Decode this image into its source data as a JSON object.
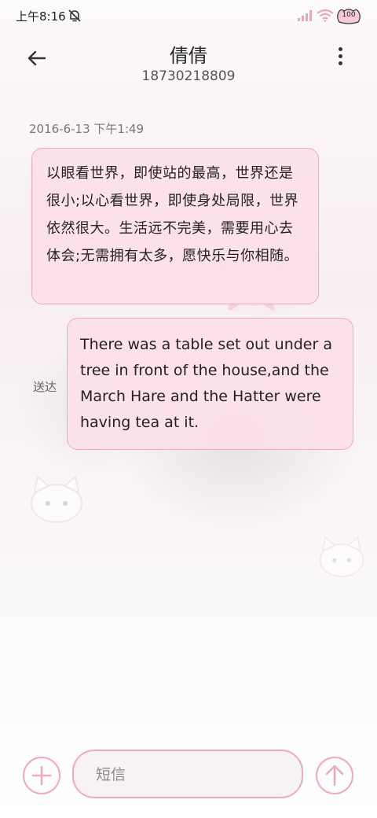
{
  "status_bar": {
    "time": "上午8:16",
    "battery": "100"
  },
  "header": {
    "contact_name": "倩倩",
    "contact_number": "18730218809"
  },
  "conversation": {
    "timestamp": "2016-6-13 下午1:49",
    "incoming_message": "以眼看世界，即使站的最高，世界还是很小;以心看世界，即使身处局限，世界依然很大。生活远不完美，需要用心去体会;无需拥有太多，愿快乐与你相随。",
    "outgoing_message": "There was a table set out under a tree in front of the house,and the March Hare and the Hatter were having tea at it.",
    "delivery_status": "送达"
  },
  "composer": {
    "placeholder": "短信"
  },
  "colors": {
    "bubble_fill": "#fce0ea",
    "bubble_border": "#f3a7c2",
    "accent_pink": "#f3a7c2"
  },
  "icons": [
    "mute-icon",
    "signal-icon",
    "wifi-icon",
    "battery-icon",
    "back-arrow-icon",
    "more-vertical-icon",
    "plus-icon",
    "send-arrow-icon"
  ]
}
